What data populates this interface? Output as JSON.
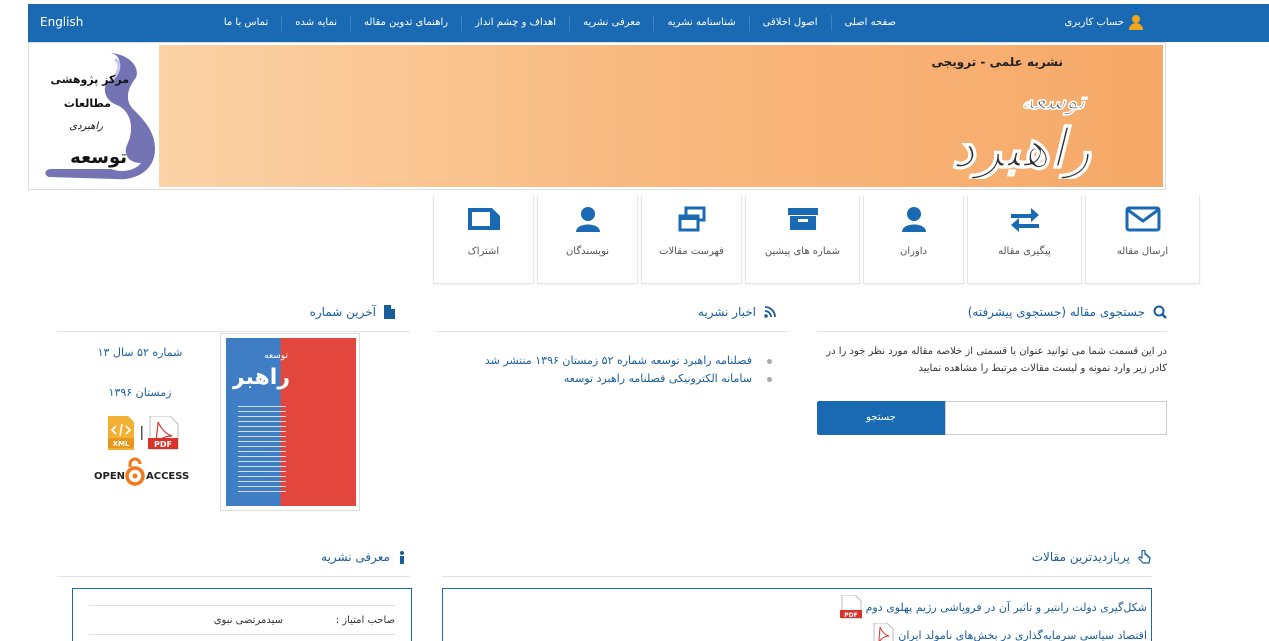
{
  "nav": {
    "language": "English",
    "menu": [
      "صفحه اصلی",
      "اصول اخلاقی",
      "شناسنامه نشریه",
      "معرفی نشریه",
      "اهداف و چشم انداز",
      "راهنمای تدوین مقاله",
      "نمایه شده",
      "تماس با ما"
    ],
    "account": "حساب کاربری"
  },
  "banner": {
    "subtitle": "نشریه علمی - ترویجی",
    "brand_top": "توسعه",
    "brand_main": "راهبرد",
    "logo_lines": [
      "مرکز پژوهشی",
      "مطالعات",
      "راهبردی",
      "توسعه"
    ]
  },
  "tiles": [
    {
      "label": "ارسال مقاله",
      "icon": "envelope-icon"
    },
    {
      "label": "پیگیری مقاله",
      "icon": "exchange-icon"
    },
    {
      "label": "داوران",
      "icon": "user-icon"
    },
    {
      "label": "شماره های پیشین",
      "icon": "archive-icon"
    },
    {
      "label": "فهرست مقالات",
      "icon": "windows-icon"
    },
    {
      "label": "نویسندگان",
      "icon": "user-icon"
    },
    {
      "label": "اشتراک",
      "icon": "folder-icon"
    }
  ],
  "search": {
    "title": "جستجوی مقاله (جستجوی پیشرفته)",
    "description": "در این قسمت شما می توانید عنوان یا قسمتی از خلاصه مقاله مورد نظر خود را در کادر زیر وارد نمونه و لیست مقالات مرتبط را مشاهده نمایید",
    "input_value": "",
    "button": "جستجو"
  },
  "news": {
    "title": "اخبار نشریه",
    "items": [
      "فصلنامه راهبرد توسعه شماره ۵۲ زمستان ۱۳۹۶ منتشر شد",
      "سامانه الکترونیکی فصلنامه راهبرد توسعه"
    ]
  },
  "latest_issue": {
    "title": "آخرین شماره",
    "issue": "شماره ۵۲ سال ۱۳",
    "season": "زمستان ۱۳۹۶",
    "xml_label": "XML",
    "pdf_label": "PDF",
    "open_access_left": "OPEN",
    "open_access_right": "ACCESS",
    "cover_title": "راهبرد",
    "cover_small": "توسعه"
  },
  "intro": {
    "title": "معرفی نشریه",
    "rows": [
      {
        "key": "صاحب امتیاز :",
        "value": "سیدمرتضی نبوی"
      }
    ]
  },
  "popular": {
    "title": "پربازدیدترین مقالات",
    "items": [
      "شکل‌گیری دولت رانتیر و تاثیر آن در فروپاشی رژیم پهلوی دوم",
      "اقتصاد سیاسی سرمایه‌گذاری در بخش‌های نامولد ایران"
    ]
  },
  "colors": {
    "primary": "#1a6ab3",
    "accent": "#f2a61b",
    "pdf_red": "#d9322b"
  }
}
